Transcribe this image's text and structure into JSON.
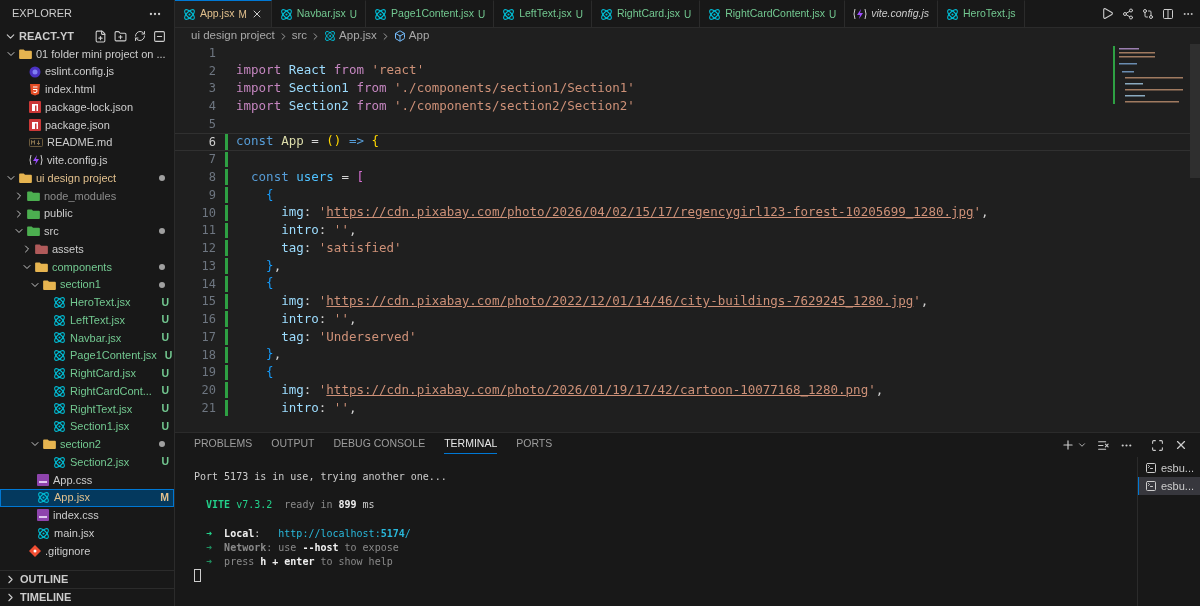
{
  "sidebar": {
    "title": "EXPLORER",
    "root": "REACT-YT",
    "tree": [
      {
        "name": "01 folder mini project on ...",
        "kind": "folder",
        "modified": false,
        "untracked": false,
        "ignored": false,
        "expanded": true,
        "selected": false,
        "dot": false,
        "children": [
          {
            "name": "eslint.config.js",
            "kind": "eslint",
            "modified": false,
            "untracked": false,
            "ignored": false,
            "selected": false
          },
          {
            "name": "index.html",
            "kind": "html",
            "modified": false,
            "untracked": false,
            "ignored": false,
            "selected": false
          },
          {
            "name": "package-lock.json",
            "kind": "npm",
            "modified": false,
            "untracked": false,
            "ignored": false,
            "selected": false
          },
          {
            "name": "package.json",
            "kind": "npm",
            "modified": false,
            "untracked": false,
            "ignored": false,
            "selected": false
          },
          {
            "name": "README.md",
            "kind": "markdown",
            "modified": false,
            "untracked": false,
            "ignored": false,
            "selected": false
          },
          {
            "name": "vite.config.js",
            "kind": "vite",
            "modified": false,
            "untracked": false,
            "ignored": false,
            "selected": false
          }
        ]
      },
      {
        "name": "ui design project",
        "kind": "folder",
        "modified": true,
        "untracked": false,
        "ignored": false,
        "expanded": true,
        "selected": false,
        "dot": true,
        "children": [
          {
            "name": "node_modules",
            "kind": "folder-green",
            "modified": false,
            "untracked": false,
            "ignored": true,
            "expanded": false,
            "selected": false,
            "dot": false
          },
          {
            "name": "public",
            "kind": "folder-green",
            "modified": false,
            "untracked": false,
            "ignored": false,
            "expanded": false,
            "selected": false,
            "dot": false
          },
          {
            "name": "src",
            "kind": "folder-green",
            "modified": false,
            "untracked": false,
            "ignored": false,
            "expanded": true,
            "selected": false,
            "dot": true,
            "children": [
              {
                "name": "assets",
                "kind": "folder-red",
                "modified": false,
                "untracked": false,
                "ignored": false,
                "expanded": false,
                "selected": false,
                "dot": false
              },
              {
                "name": "components",
                "kind": "folder",
                "modified": false,
                "untracked": true,
                "ignored": false,
                "expanded": true,
                "selected": false,
                "dot": true,
                "children": [
                  {
                    "name": "section1",
                    "kind": "folder",
                    "modified": false,
                    "untracked": true,
                    "ignored": false,
                    "expanded": true,
                    "selected": false,
                    "dot": true,
                    "children": [
                      {
                        "name": "HeroText.jsx",
                        "kind": "react",
                        "modified": false,
                        "untracked": true,
                        "ignored": false,
                        "badge": "U",
                        "selected": false
                      },
                      {
                        "name": "LeftText.jsx",
                        "kind": "react",
                        "modified": false,
                        "untracked": true,
                        "ignored": false,
                        "badge": "U",
                        "selected": false
                      },
                      {
                        "name": "Navbar.jsx",
                        "kind": "react",
                        "modified": false,
                        "untracked": true,
                        "ignored": false,
                        "badge": "U",
                        "selected": false
                      },
                      {
                        "name": "Page1Content.jsx",
                        "kind": "react",
                        "modified": false,
                        "untracked": true,
                        "ignored": false,
                        "badge": "U",
                        "selected": false
                      },
                      {
                        "name": "RightCard.jsx",
                        "kind": "react",
                        "modified": false,
                        "untracked": true,
                        "ignored": false,
                        "badge": "U",
                        "selected": false
                      },
                      {
                        "name": "RightCardCont...",
                        "kind": "react",
                        "modified": false,
                        "untracked": true,
                        "ignored": false,
                        "badge": "U",
                        "selected": false
                      },
                      {
                        "name": "RightText.jsx",
                        "kind": "react",
                        "modified": false,
                        "untracked": true,
                        "ignored": false,
                        "badge": "U",
                        "selected": false
                      },
                      {
                        "name": "Section1.jsx",
                        "kind": "react",
                        "modified": false,
                        "untracked": true,
                        "ignored": false,
                        "badge": "U",
                        "selected": false
                      }
                    ]
                  },
                  {
                    "name": "section2",
                    "kind": "folder",
                    "modified": false,
                    "untracked": true,
                    "ignored": false,
                    "expanded": true,
                    "selected": false,
                    "dot": true,
                    "children": [
                      {
                        "name": "Section2.jsx",
                        "kind": "react",
                        "modified": false,
                        "untracked": true,
                        "ignored": false,
                        "badge": "U",
                        "selected": false
                      }
                    ]
                  }
                ]
              },
              {
                "name": "App.css",
                "kind": "css",
                "modified": false,
                "untracked": false,
                "ignored": false,
                "selected": false
              },
              {
                "name": "App.jsx",
                "kind": "react",
                "modified": true,
                "untracked": false,
                "ignored": false,
                "badge": "M",
                "selected": true
              },
              {
                "name": "index.css",
                "kind": "css",
                "modified": false,
                "untracked": false,
                "ignored": false,
                "selected": false
              },
              {
                "name": "main.jsx",
                "kind": "react",
                "modified": false,
                "untracked": false,
                "ignored": false,
                "selected": false
              }
            ]
          },
          {
            "name": ".gitignore",
            "kind": "git",
            "modified": false,
            "untracked": false,
            "ignored": false,
            "selected": false
          }
        ]
      }
    ],
    "sections": [
      {
        "label": "OUTLINE",
        "expanded": false
      },
      {
        "label": "TIMELINE",
        "expanded": false
      }
    ]
  },
  "tabs": [
    {
      "label": "App.jsx",
      "badge": "M",
      "kind": "react",
      "modified": true,
      "untracked": false,
      "selected": true,
      "preview": false
    },
    {
      "label": "Navbar.jsx",
      "badge": "U",
      "kind": "react",
      "modified": false,
      "untracked": true,
      "selected": false,
      "preview": false
    },
    {
      "label": "Page1Content.jsx",
      "badge": "U",
      "kind": "react",
      "modified": false,
      "untracked": true,
      "selected": false,
      "preview": false
    },
    {
      "label": "LeftText.jsx",
      "badge": "U",
      "kind": "react",
      "modified": false,
      "untracked": true,
      "selected": false,
      "preview": false
    },
    {
      "label": "RightCard.jsx",
      "badge": "U",
      "kind": "react",
      "modified": false,
      "untracked": true,
      "selected": false,
      "preview": false
    },
    {
      "label": "RightCardContent.jsx",
      "badge": "U",
      "kind": "react",
      "modified": false,
      "untracked": true,
      "selected": false,
      "preview": false
    },
    {
      "label": "vite.config.js",
      "kind": "vite",
      "modified": false,
      "untracked": false,
      "selected": false,
      "preview": true
    },
    {
      "label": "HeroText.js",
      "kind": "react",
      "modified": false,
      "untracked": true,
      "selected": false,
      "preview": false
    }
  ],
  "breadcrumb": [
    {
      "label": "ui design project",
      "kind": "plain"
    },
    {
      "label": "src",
      "kind": "plain"
    },
    {
      "label": "App.jsx",
      "kind": "react"
    },
    {
      "label": "App",
      "kind": "symbol"
    }
  ],
  "editor": {
    "lines": [
      {
        "number": "1",
        "selected": false,
        "added": false
      },
      {
        "number": "2",
        "selected": false,
        "added": false,
        "tokens": [
          {
            "text": "import ",
            "kind": "keyword"
          },
          {
            "text": "React ",
            "kind": "variable"
          },
          {
            "text": "from ",
            "kind": "keyword"
          },
          {
            "text": "'react'",
            "kind": "string"
          }
        ]
      },
      {
        "number": "3",
        "selected": false,
        "added": false,
        "tokens": [
          {
            "text": "import ",
            "kind": "keyword"
          },
          {
            "text": "Section1 ",
            "kind": "variable"
          },
          {
            "text": "from ",
            "kind": "keyword"
          },
          {
            "text": "'./components/section1/Section1'",
            "kind": "string"
          }
        ]
      },
      {
        "number": "4",
        "selected": false,
        "added": false,
        "tokens": [
          {
            "text": "import ",
            "kind": "keyword"
          },
          {
            "text": "Section2 ",
            "kind": "variable"
          },
          {
            "text": "from ",
            "kind": "keyword"
          },
          {
            "text": "'./components/section2/Section2'",
            "kind": "string"
          }
        ]
      },
      {
        "number": "5",
        "selected": false,
        "added": false
      },
      {
        "number": "6",
        "selected": true,
        "added": true,
        "tokens": [
          {
            "text": "const ",
            "kind": "storage"
          },
          {
            "text": "App",
            "kind": "function"
          },
          {
            "text": " = ",
            "kind": "punct"
          },
          {
            "text": "()",
            "kind": "bracket1"
          },
          {
            "text": " => ",
            "kind": "storage"
          },
          {
            "text": "{",
            "kind": "bracket1"
          }
        ]
      },
      {
        "number": "7",
        "selected": false,
        "added": true
      },
      {
        "number": "8",
        "selected": false,
        "added": true,
        "tokens": [
          {
            "text": "  const ",
            "kind": "storage"
          },
          {
            "text": "users",
            "kind": "constant"
          },
          {
            "text": " = ",
            "kind": "punct"
          },
          {
            "text": "[",
            "kind": "bracket2"
          }
        ]
      },
      {
        "number": "9",
        "selected": false,
        "added": true,
        "tokens": [
          {
            "text": "    {",
            "kind": "bracket3"
          }
        ]
      },
      {
        "number": "10",
        "selected": false,
        "added": true,
        "tokens": [
          {
            "text": "      img",
            "kind": "property"
          },
          {
            "text": ": ",
            "kind": "punct"
          },
          {
            "text": "'",
            "kind": "string"
          },
          {
            "text": "https://cdn.pixabay.com/photo/2026/04/02/15/17/regencygirl123-forest-10205699_1280.jpg",
            "kind": "link"
          },
          {
            "text": "'",
            "kind": "string"
          },
          {
            "text": ",",
            "kind": "punct"
          }
        ]
      },
      {
        "number": "11",
        "selected": false,
        "added": true,
        "tokens": [
          {
            "text": "      intro",
            "kind": "property"
          },
          {
            "text": ": ",
            "kind": "punct"
          },
          {
            "text": "''",
            "kind": "string"
          },
          {
            "text": ",",
            "kind": "punct"
          }
        ]
      },
      {
        "number": "12",
        "selected": false,
        "added": true,
        "tokens": [
          {
            "text": "      tag",
            "kind": "property"
          },
          {
            "text": ": ",
            "kind": "punct"
          },
          {
            "text": "'satisfied'",
            "kind": "string"
          }
        ]
      },
      {
        "number": "13",
        "selected": false,
        "added": true,
        "tokens": [
          {
            "text": "    }",
            "kind": "bracket3"
          },
          {
            "text": ",",
            "kind": "punct"
          }
        ]
      },
      {
        "number": "14",
        "selected": false,
        "added": true,
        "tokens": [
          {
            "text": "    {",
            "kind": "bracket3"
          }
        ]
      },
      {
        "number": "15",
        "selected": false,
        "added": true,
        "tokens": [
          {
            "text": "      img",
            "kind": "property"
          },
          {
            "text": ": ",
            "kind": "punct"
          },
          {
            "text": "'",
            "kind": "string"
          },
          {
            "text": "https://cdn.pixabay.com/photo/2022/12/01/14/46/city-buildings-7629245_1280.jpg",
            "kind": "link"
          },
          {
            "text": "'",
            "kind": "string"
          },
          {
            "text": ",",
            "kind": "punct"
          }
        ]
      },
      {
        "number": "16",
        "selected": false,
        "added": true,
        "tokens": [
          {
            "text": "      intro",
            "kind": "property"
          },
          {
            "text": ": ",
            "kind": "punct"
          },
          {
            "text": "''",
            "kind": "string"
          },
          {
            "text": ",",
            "kind": "punct"
          }
        ]
      },
      {
        "number": "17",
        "selected": false,
        "added": true,
        "tokens": [
          {
            "text": "      tag",
            "kind": "property"
          },
          {
            "text": ": ",
            "kind": "punct"
          },
          {
            "text": "'Underserved'",
            "kind": "string"
          }
        ]
      },
      {
        "number": "18",
        "selected": false,
        "added": true,
        "tokens": [
          {
            "text": "    }",
            "kind": "bracket3"
          },
          {
            "text": ",",
            "kind": "punct"
          }
        ]
      },
      {
        "number": "19",
        "selected": false,
        "added": true,
        "tokens": [
          {
            "text": "    {",
            "kind": "bracket3"
          }
        ]
      },
      {
        "number": "20",
        "selected": false,
        "added": true,
        "tokens": [
          {
            "text": "      img",
            "kind": "property"
          },
          {
            "text": ": ",
            "kind": "punct"
          },
          {
            "text": "'",
            "kind": "string"
          },
          {
            "text": "https://cdn.pixabay.com/photo/2026/01/19/17/42/cartoon-10077168_1280.png",
            "kind": "link"
          },
          {
            "text": "'",
            "kind": "string"
          },
          {
            "text": ",",
            "kind": "punct"
          }
        ]
      },
      {
        "number": "21",
        "selected": false,
        "added": true,
        "tokens": [
          {
            "text": "      intro",
            "kind": "property"
          },
          {
            "text": ": ",
            "kind": "punct"
          },
          {
            "text": "''",
            "kind": "string"
          },
          {
            "text": ",",
            "kind": "punct"
          }
        ]
      }
    ]
  },
  "panel": {
    "tabs": [
      {
        "label": "PROBLEMS",
        "selected": false
      },
      {
        "label": "OUTPUT",
        "selected": false
      },
      {
        "label": "DEBUG CONSOLE",
        "selected": false
      },
      {
        "label": "TERMINAL",
        "selected": true
      },
      {
        "label": "PORTS",
        "selected": false
      }
    ],
    "terminal": [
      {
        "kind": "text",
        "tokens": [
          {
            "text": "Port 5173 is in use, trying another one...",
            "kind": "plain"
          }
        ]
      },
      {
        "kind": "blank"
      },
      {
        "kind": "text",
        "tokens": [
          {
            "text": "  VITE",
            "kind": "green-bold"
          },
          {
            "text": " v7.3.2",
            "kind": "green"
          },
          {
            "text": "  ready in ",
            "kind": "dim"
          },
          {
            "text": "899",
            "kind": "bold"
          },
          {
            "text": " ms",
            "kind": "plain"
          }
        ]
      },
      {
        "kind": "blank"
      },
      {
        "kind": "text",
        "tokens": [
          {
            "text": "  ➜  ",
            "kind": "green"
          },
          {
            "text": "Local",
            "kind": "bold"
          },
          {
            "text": ":   ",
            "kind": "plain"
          },
          {
            "text": "http://localhost:",
            "kind": "link"
          },
          {
            "text": "5174",
            "kind": "link-bold"
          },
          {
            "text": "/",
            "kind": "link"
          }
        ]
      },
      {
        "kind": "text",
        "tokens": [
          {
            "text": "  ➜  ",
            "kind": "green-dim"
          },
          {
            "text": "Network",
            "kind": "dim-bold"
          },
          {
            "text": ": use ",
            "kind": "dim"
          },
          {
            "text": "--host",
            "kind": "bold"
          },
          {
            "text": " to expose",
            "kind": "dim"
          }
        ]
      },
      {
        "kind": "text",
        "tokens": [
          {
            "text": "  ➜  ",
            "kind": "green-dim"
          },
          {
            "text": "press ",
            "kind": "dim"
          },
          {
            "text": "h + enter",
            "kind": "bold"
          },
          {
            "text": " to show help",
            "kind": "dim"
          }
        ]
      },
      {
        "kind": "cursor"
      }
    ],
    "terminals": [
      {
        "label": "esbu...",
        "selected": false
      },
      {
        "label": "esbu...",
        "selected": true
      }
    ]
  }
}
